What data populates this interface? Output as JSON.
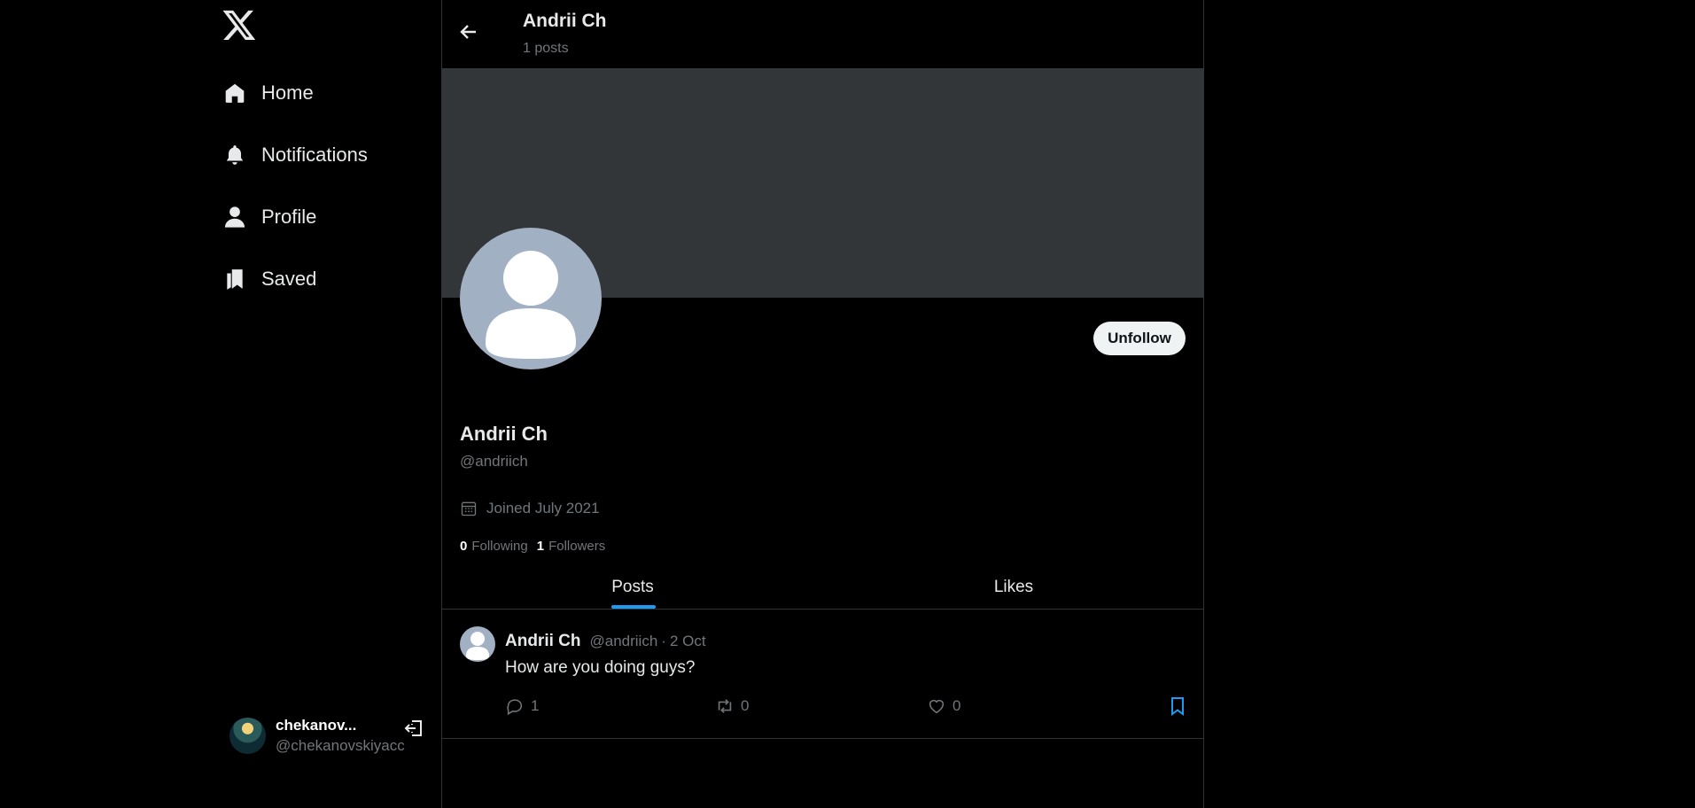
{
  "nav": {
    "items": [
      {
        "label": "Home",
        "icon": "home-icon"
      },
      {
        "label": "Notifications",
        "icon": "bell-icon"
      },
      {
        "label": "Profile",
        "icon": "person-icon"
      },
      {
        "label": "Saved",
        "icon": "bookmarks-icon"
      }
    ]
  },
  "current_user": {
    "name": "chekanov...",
    "handle": "@chekanovskiyacc"
  },
  "header": {
    "title": "Andrii Ch",
    "subtitle": "1 posts"
  },
  "profile": {
    "name": "Andrii Ch",
    "handle": "@andriich",
    "joined": "Joined July 2021",
    "follow_button": "Unfollow",
    "following_count": "0",
    "following_label": "Following",
    "followers_count": "1",
    "followers_label": "Followers"
  },
  "tabs": [
    {
      "label": "Posts",
      "active": true
    },
    {
      "label": "Likes",
      "active": false
    }
  ],
  "posts": [
    {
      "author": "Andrii Ch",
      "handle": "@andriich",
      "separator": "·",
      "date": "2 Oct",
      "text": "How are you doing guys?",
      "replies": "1",
      "reposts": "0",
      "likes": "0"
    }
  ],
  "colors": {
    "background": "#000000",
    "banner": "#333639",
    "accent": "#1d9bf0",
    "muted_text": "#71767b",
    "avatar_placeholder": "#a2b0c4"
  }
}
